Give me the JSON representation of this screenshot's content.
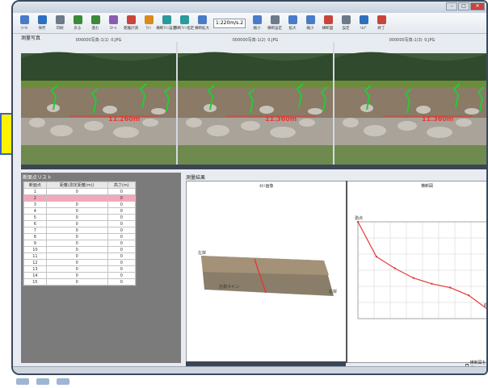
{
  "window": {
    "title": ""
  },
  "toolbar": {
    "combo_value": "1:220m/s.2",
    "items": [
      {
        "label": "ﾌｧｲﾙ",
        "icon": "file-icon",
        "color": "#4a7bc8"
      },
      {
        "label": "保存",
        "icon": "save-icon",
        "color": "#2f6fbf"
      },
      {
        "label": "印刷",
        "icon": "print-icon",
        "color": "#6c7a89"
      },
      {
        "label": "戻る",
        "icon": "undo-icon",
        "color": "#3a8a3a"
      },
      {
        "label": "進む",
        "icon": "redo-icon",
        "color": "#3a8a3a"
      },
      {
        "label": "ｽｹｰﾙ",
        "icon": "scale-icon",
        "color": "#8a5cb0"
      },
      {
        "label": "距離計測",
        "icon": "measure-icon",
        "color": "#c8453c"
      },
      {
        "label": "ﾗｲﾝ",
        "icon": "line-icon",
        "color": "#d88a1e"
      },
      {
        "label": "横断ﾗｲﾝ設定",
        "icon": "section-line-icon",
        "color": "#2a9a9a"
      },
      {
        "label": "横断ﾗｲﾝ指定",
        "icon": "section-pick-icon",
        "color": "#2a9a9a"
      },
      {
        "label": "横断拡大",
        "icon": "zoom-icon",
        "color": "#4a7bc8"
      },
      {
        "label": "縮小",
        "icon": "zoom-out-icon",
        "color": "#4a7bc8"
      },
      {
        "label": "横断設定",
        "icon": "settings-icon",
        "color": "#6c7a89"
      },
      {
        "label": "拡大",
        "icon": "zoom-in-icon",
        "color": "#4a7bc8"
      },
      {
        "label": "縮小",
        "icon": "shrink-icon",
        "color": "#4a7bc8"
      },
      {
        "label": "横断図",
        "icon": "chart-icon",
        "color": "#c8453c"
      },
      {
        "label": "設定",
        "icon": "gear-icon",
        "color": "#6c7a89"
      },
      {
        "label": "ﾍﾙﾌﾟ",
        "icon": "help-icon",
        "color": "#2f6fbf"
      },
      {
        "label": "終了",
        "icon": "exit-icon",
        "color": "#c8453c"
      }
    ]
  },
  "photos_section": {
    "label": "測量写真",
    "captions": [
      "000000写真-1(1)_0.JPG",
      "000000写真-1(2)_0.JPG",
      "000000写真-1(3)_0.JPG"
    ],
    "dimension_labels": [
      "11.260m",
      "11.360m",
      "11.360m"
    ]
  },
  "table_section": {
    "label": "断面点リスト",
    "columns": [
      "断面点",
      "距離(測定距離(m))",
      "高さ(m)"
    ],
    "rows": [
      {
        "no": "1",
        "dist": "0",
        "h": "0"
      },
      {
        "no": "2",
        "dist": "",
        "h": "0"
      },
      {
        "no": "3",
        "dist": "0",
        "h": "0"
      },
      {
        "no": "4",
        "dist": "0",
        "h": "0"
      },
      {
        "no": "5",
        "dist": "0",
        "h": "0"
      },
      {
        "no": "6",
        "dist": "0",
        "h": "0"
      },
      {
        "no": "7",
        "dist": "0",
        "h": "0"
      },
      {
        "no": "8",
        "dist": "0",
        "h": "0"
      },
      {
        "no": "9",
        "dist": "0",
        "h": "0"
      },
      {
        "no": "10",
        "dist": "0",
        "h": "0"
      },
      {
        "no": "11",
        "dist": "0",
        "h": "0"
      },
      {
        "no": "12",
        "dist": "0",
        "h": "0"
      },
      {
        "no": "13",
        "dist": "0",
        "h": "0"
      },
      {
        "no": "14",
        "dist": "0",
        "h": "0"
      },
      {
        "no": "15",
        "dist": "0",
        "h": "0"
      }
    ],
    "selected_row": 1
  },
  "results_section": {
    "label": "測量結果",
    "left_title": "ｵﾙｿ画像",
    "right_title": "横断図",
    "ortho_labels": [
      "左岸",
      "右岸",
      "計測ライン"
    ],
    "checkbox_label": "横断図を反転表示"
  },
  "colors": {
    "accent": "#e53935",
    "highlight": "#fff200",
    "selected_row": "#f4a7b9"
  },
  "chart_data": {
    "type": "line",
    "title": "",
    "xlabel": "",
    "ylabel": "",
    "series": [
      {
        "values": [
          100,
          64,
          52,
          42,
          36,
          32,
          24,
          10
        ]
      }
    ],
    "x": [
      0,
      1,
      2,
      3,
      4,
      5,
      6,
      7
    ],
    "ylim": [
      0,
      100
    ],
    "grid": true,
    "point_labels": [
      "測点",
      "",
      "",
      "",
      "",
      "",
      "",
      "終点"
    ]
  }
}
